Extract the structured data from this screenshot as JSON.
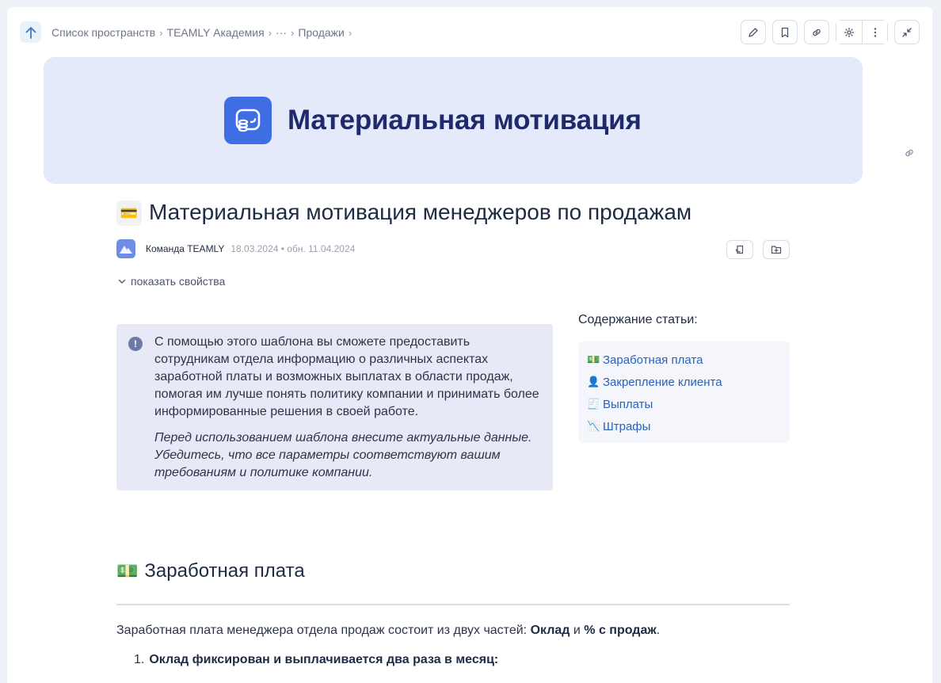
{
  "breadcrumb": {
    "items": [
      "Список пространств",
      "TEAMLY Академия",
      "···",
      "Продажи"
    ]
  },
  "toolbar": {
    "buttons": [
      "pencil-icon",
      "bookmark-icon",
      "link-icon",
      "gear-icon",
      "more-vertical-icon",
      "collapse-icon"
    ]
  },
  "banner": {
    "title": "Материальная мотивация"
  },
  "document": {
    "emoji": "💳",
    "title": "Материальная мотивация менеджеров по продажам",
    "author": "Команда TEAMLY",
    "dates": "18.03.2024 • обн. 11.04.2024",
    "properties_toggle": "показать свойства"
  },
  "info": {
    "text": "С помощью этого шаблона вы сможете предоставить сотрудникам отдела информацию о различных аспектах заработной платы и возможных выплатах в области продаж, помогая им лучше понять политику компании и принимать более информированные решения в своей работе.",
    "note": "Перед использованием шаблона внесите актуальные данные. Убедитесь, что все параметры соответствуют вашим требованиям и политике компании."
  },
  "toc": {
    "heading": "Содержание статьи:",
    "items": [
      {
        "icon": "💵",
        "label": "Заработная плата"
      },
      {
        "icon": "👤",
        "label": "Закрепление клиента"
      },
      {
        "icon": "🧾",
        "label": "Выплаты"
      },
      {
        "icon": "📉",
        "label": "Штрафы"
      }
    ]
  },
  "section": {
    "icon": "💵",
    "heading": "Заработная плата",
    "para_before": "Заработная плата менеджера отдела продаж состоит из двух частей: ",
    "para_bold1": "Оклад",
    "para_mid": " и ",
    "para_bold2": "% с продаж",
    "para_after": ".",
    "list_num": "1.",
    "list_text": "Оклад фиксирован и выплачивается два раза в месяц:"
  },
  "colors": {
    "accent": "#3f6ee4",
    "link": "#2a62b8",
    "banner_bg": "#e5eafb",
    "info_bg": "#e7eaf6"
  }
}
